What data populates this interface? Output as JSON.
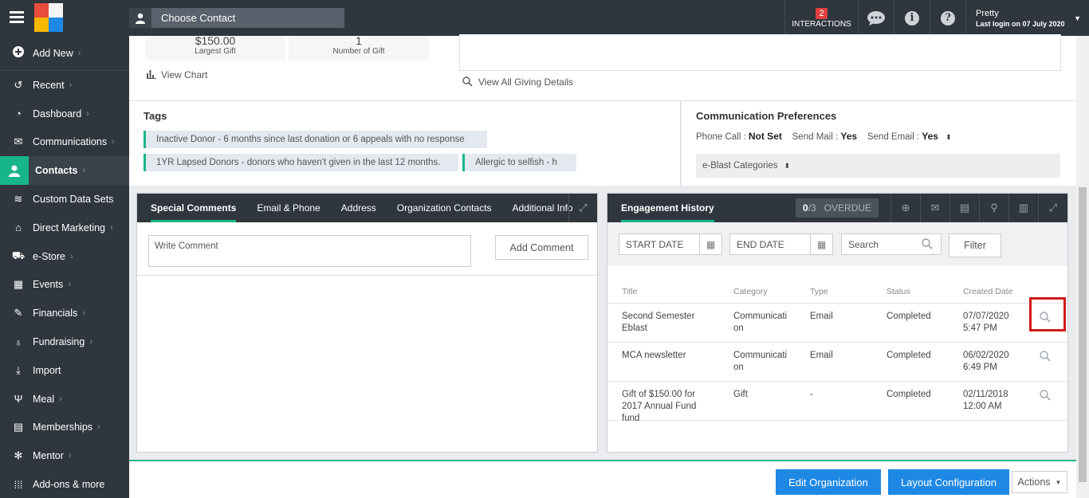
{
  "topbar": {
    "contact_placeholder": "Choose Contact",
    "interactions_count": "2",
    "interactions_label": "INTERACTIONS",
    "user_name": "Pretty",
    "last_login": "Last login on 07 July 2020"
  },
  "sidebar": {
    "add_new": "Add New",
    "items": [
      {
        "label": "Recent",
        "icon": "history-icon",
        "glyph": "↺",
        "chev": true
      },
      {
        "label": "Dashboard",
        "icon": "dashboard-icon",
        "glyph": "◔",
        "chev": true
      },
      {
        "label": "Communications",
        "icon": "mail-icon",
        "glyph": "✉",
        "chev": true
      },
      {
        "label": "Contacts",
        "icon": "user-icon",
        "glyph": "●",
        "chev": true,
        "active": true
      },
      {
        "label": "Custom Data Sets",
        "icon": "database-icon",
        "glyph": "≋",
        "chev": false
      },
      {
        "label": "Direct Marketing",
        "icon": "bank-icon",
        "glyph": "⌂",
        "chev": true
      },
      {
        "label": "e-Store",
        "icon": "cart-icon",
        "glyph": "⛟",
        "chev": true
      },
      {
        "label": "Events",
        "icon": "calendar-icon",
        "glyph": "▦",
        "chev": true
      },
      {
        "label": "Financials",
        "icon": "money-icon",
        "glyph": "✎",
        "chev": true
      },
      {
        "label": "Fundraising",
        "icon": "moneybag-icon",
        "glyph": "♁",
        "chev": true
      },
      {
        "label": "Import",
        "icon": "import-icon",
        "glyph": "⤓",
        "chev": false
      },
      {
        "label": "Meal",
        "icon": "cutlery-icon",
        "glyph": "Ψ",
        "chev": true
      },
      {
        "label": "Memberships",
        "icon": "id-card-icon",
        "glyph": "▤",
        "chev": true
      },
      {
        "label": "Mentor",
        "icon": "mentor-icon",
        "glyph": "✻",
        "chev": true
      },
      {
        "label": "Add-ons & more",
        "icon": "grid-icon",
        "glyph": "⁞⁞⁞",
        "chev": false
      }
    ]
  },
  "giving": {
    "largest_gift_value": "$150.00",
    "largest_gift_label": "Largest Gift",
    "num_gifts_value": "1",
    "num_gifts_label": "Number of Gift",
    "view_chart": "View Chart",
    "view_all": "View All Giving Details"
  },
  "tags": {
    "title": "Tags",
    "items": [
      "Inactive Donor - 6 months since last donation or 6 appeals with no response",
      "1YR Lapsed Donors - donors who haven't given in the last 12 months.",
      "Allergic to selfish - h"
    ]
  },
  "comm": {
    "title": "Communication Preferences",
    "phone_label": "Phone Call :",
    "phone_value": "Not Set",
    "mail_label": "Send Mail :",
    "mail_value": "Yes",
    "email_label": "Send Email :",
    "email_value": "Yes",
    "eblast": "e-Blast Categories"
  },
  "comments_panel": {
    "tabs": [
      "Special Comments",
      "Email & Phone",
      "Address",
      "Organization Contacts",
      "Additional Info"
    ],
    "placeholder": "Write Comment",
    "add_button": "Add Comment"
  },
  "engagement": {
    "title": "Engagement History",
    "overdue_count": "0",
    "overdue_total": "/3",
    "overdue_label": "OVERDUE",
    "start_date": "START DATE",
    "end_date": "END DATE",
    "search": "Search",
    "filter": "Filter",
    "columns": [
      "Title",
      "Category",
      "Type",
      "Status",
      "Created Date"
    ],
    "rows": [
      {
        "title": [
          "Second Semester",
          "Eblast"
        ],
        "category": [
          "Communicati",
          "on"
        ],
        "type": "Email",
        "status": "Completed",
        "date": [
          "07/07/2020",
          "5:47 PM"
        ]
      },
      {
        "title": [
          "MCA newsletter"
        ],
        "category": [
          "Communicati",
          "on"
        ],
        "type": "Email",
        "status": "Completed",
        "date": [
          "06/02/2020",
          "6:49 PM"
        ]
      },
      {
        "title": [
          "Gift of $150.00 for",
          "2017 Annual Fund",
          "fund"
        ],
        "category": [
          "Gift"
        ],
        "type": "-",
        "status": "Completed",
        "date": [
          "02/11/2018",
          "12:00 AM"
        ]
      }
    ]
  },
  "bottom": {
    "edit_org": "Edit Organization",
    "layout_config": "Layout Configuration",
    "actions": "Actions"
  },
  "colors": {
    "accent": "#19b58a",
    "primary": "#1e88e5",
    "dark": "#2f363e",
    "highlight": "#d11a1a"
  }
}
